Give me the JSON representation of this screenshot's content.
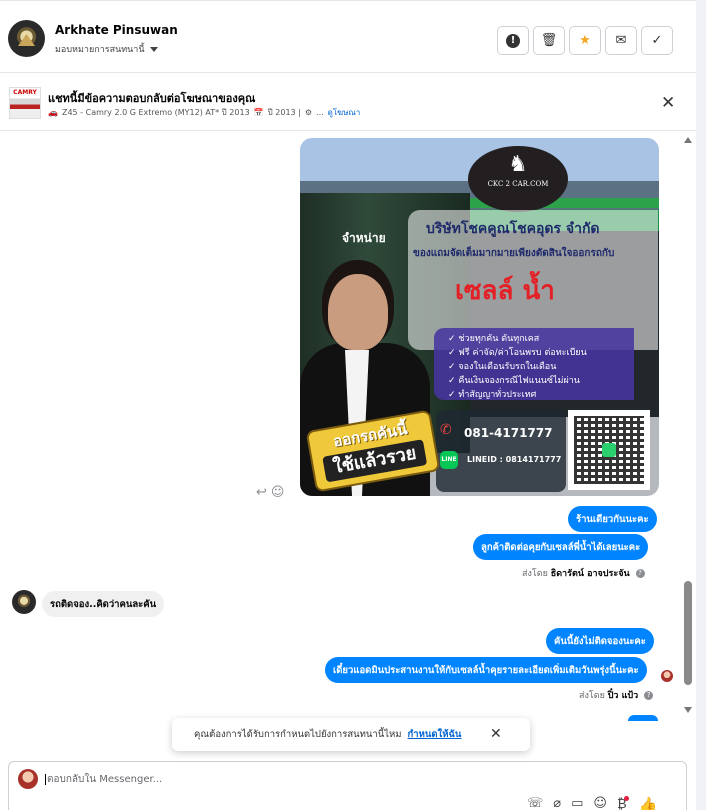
{
  "header": {
    "user_name": "Arkhate Pinsuwan",
    "assignee": "มอบหมายการสนทนานี้",
    "buttons": [
      {
        "icon": "alert-icon",
        "glyph": "!"
      },
      {
        "icon": "trash-icon",
        "glyph": "🗑"
      },
      {
        "icon": "star-icon",
        "glyph": "★"
      },
      {
        "icon": "envelope-icon",
        "glyph": "✉"
      },
      {
        "icon": "check-icon",
        "glyph": "✓"
      }
    ]
  },
  "ad": {
    "title": "แชทนี้มีข้อความตอบกลับต่อโฆษณาของคุณ",
    "thumb_text": "CAMRY",
    "car_icon": "🚗",
    "model": "Z45 - Camry 2.0 G Extremo (MY12) AT* ปี 2013",
    "calendar_icon": "📅",
    "year": "ปี 2013 |",
    "gear_icon": "⚙",
    "ellipsis": "...",
    "view_ad": "ดูโฆษณา"
  },
  "promo": {
    "logo_text": "CKC 2 CAR.COM",
    "sign": "จำหน่าย",
    "company": "บริษัทโชคคูณโชคอุดร จำกัด",
    "tagline": "ของแถมจัดเต็มมากมายเพียงตัดสินใจออกรถกับ",
    "sales_name": "เซลล์ น้ำ",
    "features": [
      "✓ ช่วยทุกคัน ดันทุกเคส",
      "✓ ฟรี ค่าจัด/ค่าโอนพรบ ต่อทะเบียน",
      "✓ จองในเดือนรับรถในเดือน",
      "✓ คืนเงินจองกรณีไฟแนนซ์ไม่ผ่าน",
      "✓ ทำสัญญาทั่วประเทศ"
    ],
    "phone": "081-4171777",
    "line_badge": "LINE",
    "line_id": "LINEID : 0814171777",
    "badge_line1": "ออกรถคันนี้",
    "badge_line2": "ใช้แล้วรวย"
  },
  "messages": {
    "out1": "ร้านเดียวกันนะคะ",
    "out2": "ลูกค้าติดต่อคุยกับเซลล์พี่น้ำได้เลยนะคะ",
    "sent_by_1_prefix": "ส่งโดย",
    "sent_by_1_name": "ธิดารัตน์ อาจประจัน",
    "in1": "รถติดจอง..คิดว่าคนละคัน",
    "out3": "คันนี้ยังไม่ติดจองนะคะ",
    "out4": "เดี๋ยวแอดมินประสานงานให้กับเซลล์น้ำคุยรายละเอียดเพิ่มเติมวันพรุ่งนี้นะคะ",
    "sent_by_2_prefix": "ส่งโดย",
    "sent_by_2_name": "ปิ๋ว แป้ว",
    "info_glyph": "?"
  },
  "toast": {
    "text": "คุณต้องการได้รับการกำหนดไปยังการสนทนานี้ไหม",
    "link": "กำหนดให้ฉัน"
  },
  "composer": {
    "placeholder": "ตอบกลับใน Messenger..."
  }
}
